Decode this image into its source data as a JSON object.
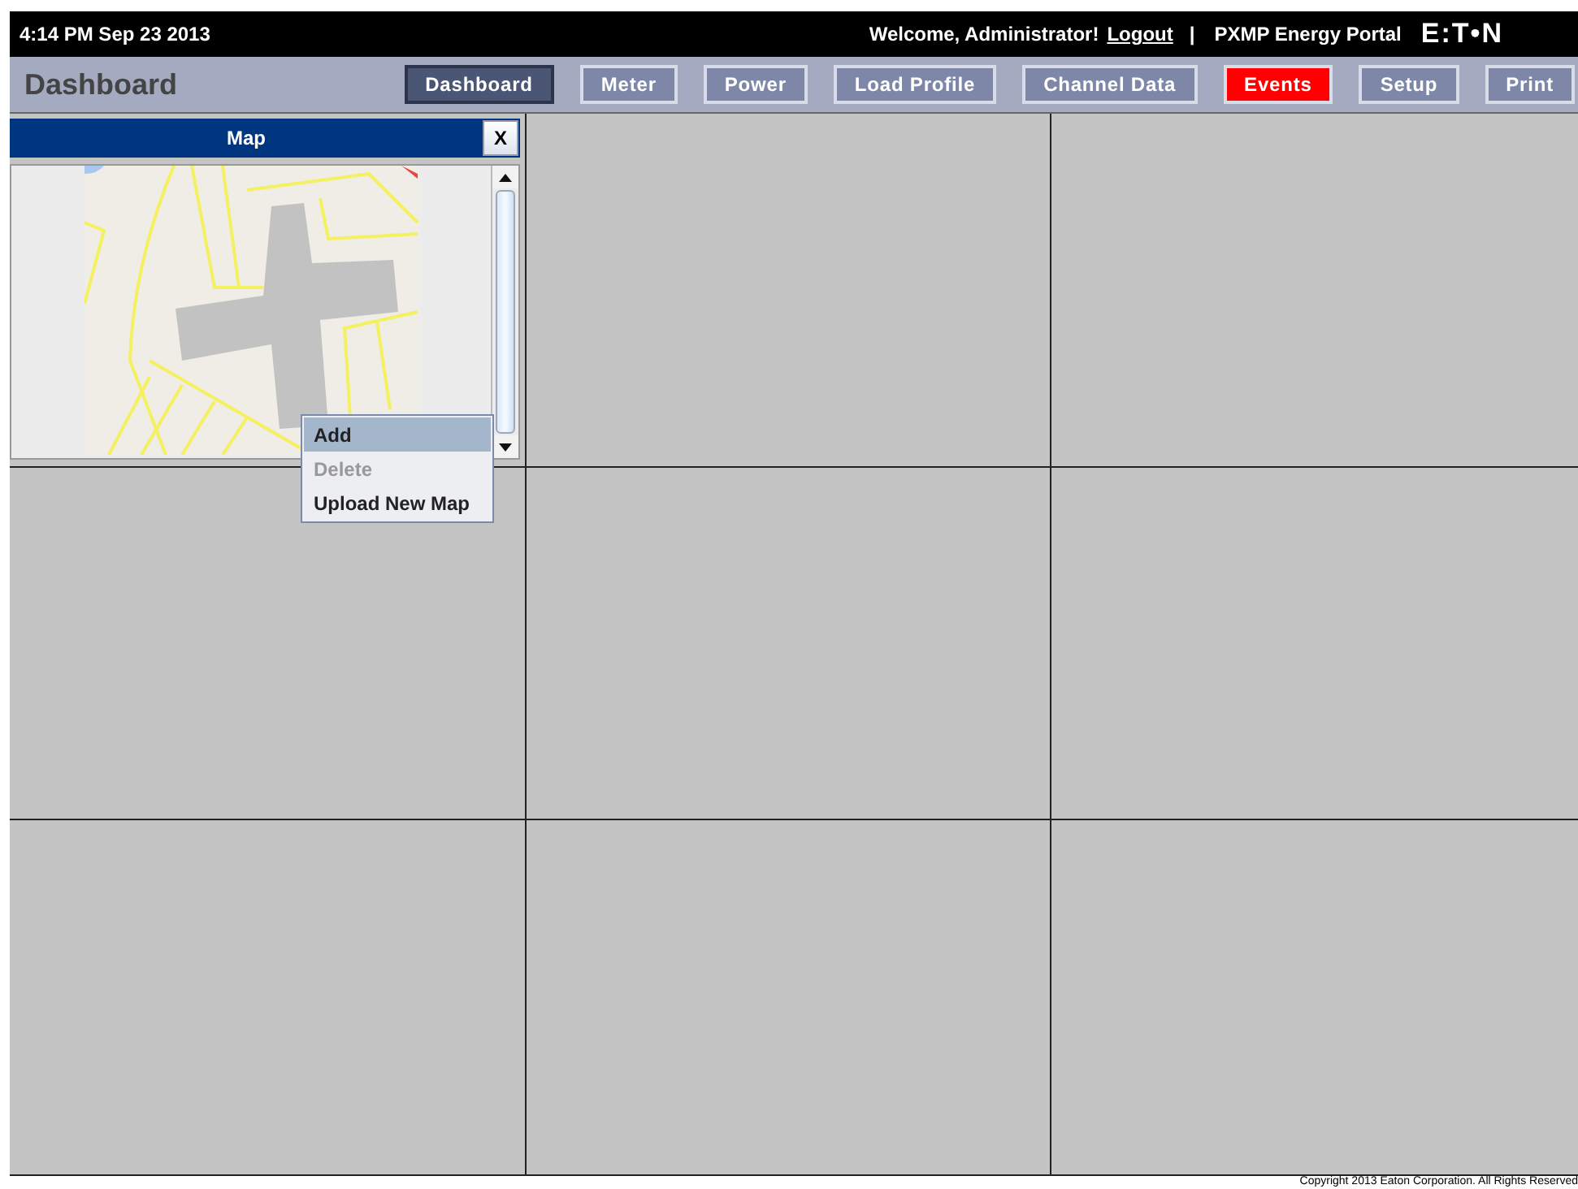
{
  "top_bar": {
    "datetime": "4:14 PM Sep 23 2013",
    "welcome": "Welcome, Administrator!",
    "logout": "Logout",
    "separator": "|",
    "portal": "PXMP Energy Portal",
    "logo": "E:T•N"
  },
  "nav": {
    "title": "Dashboard",
    "buttons": [
      {
        "label": "Dashboard",
        "selected": true,
        "kind": "normal"
      },
      {
        "label": "Meter",
        "selected": false,
        "kind": "normal"
      },
      {
        "label": "Power",
        "selected": false,
        "kind": "normal"
      },
      {
        "label": "Load Profile",
        "selected": false,
        "kind": "normal"
      },
      {
        "label": "Channel Data",
        "selected": false,
        "kind": "normal"
      },
      {
        "label": "Events",
        "selected": false,
        "kind": "alert"
      },
      {
        "label": "Setup",
        "selected": false,
        "kind": "normal"
      },
      {
        "label": "Print",
        "selected": false,
        "kind": "normal"
      }
    ]
  },
  "map_panel": {
    "title": "Map",
    "close": "X"
  },
  "context_menu": [
    {
      "label": "Add",
      "selected": true,
      "disabled": false
    },
    {
      "label": "Delete",
      "selected": false,
      "disabled": true
    },
    {
      "label": "Upload New Map",
      "selected": false,
      "disabled": false
    }
  ],
  "footer": "Copyright 2013 Eaton Corporation. All Rights Reserved"
}
